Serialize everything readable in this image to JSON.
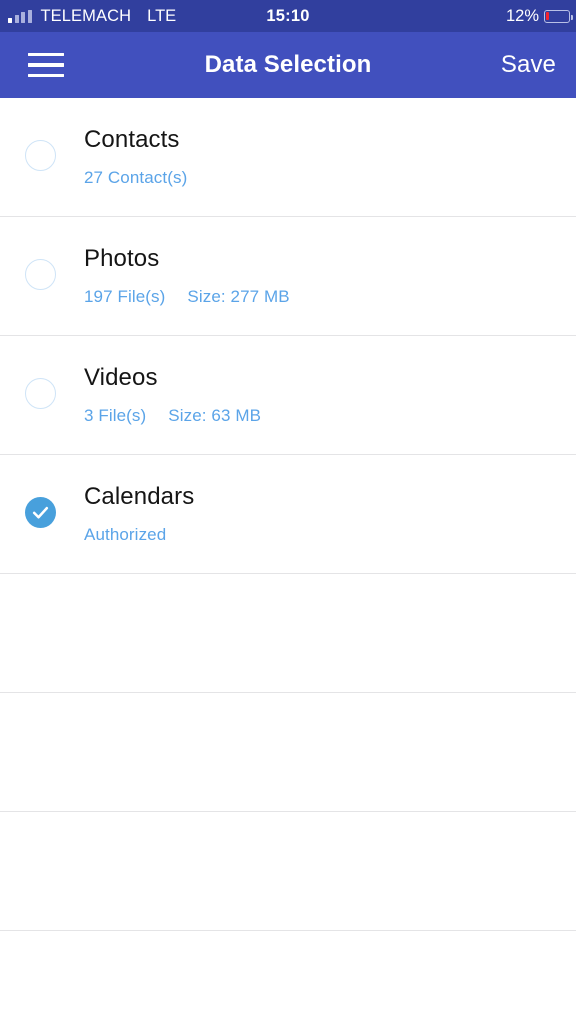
{
  "status_bar": {
    "carrier": "TELEMACH",
    "network": "LTE",
    "time": "15:10",
    "battery_percent_label": "12%",
    "battery_level": 12,
    "signal_bars": 4,
    "signal_icon": "signal-bars-icon",
    "battery_icon": "battery-icon",
    "battery_fill_color": "#f5222d"
  },
  "navbar": {
    "menu_icon": "hamburger-menu-icon",
    "title": "Data Selection",
    "save_label": "Save",
    "background_color": "#4150be"
  },
  "theme": {
    "status_bar_color": "#313f9e",
    "nav_color": "#4150be",
    "subtitle_color": "#5ba4e8",
    "checked_color": "#48a0dc",
    "unchecked_border_color": "#cfe4f7",
    "separator_color": "#e4e4e6"
  },
  "list": {
    "items": [
      {
        "title": "Contacts",
        "sub1": "27 Contact(s)",
        "sub2": "",
        "checked": false,
        "checkbox_name": "checkbox-contacts"
      },
      {
        "title": "Photos",
        "sub1": "197 File(s)",
        "sub2": "Size: 277 MB",
        "checked": false,
        "checkbox_name": "checkbox-photos"
      },
      {
        "title": "Videos",
        "sub1": "3 File(s)",
        "sub2": "Size: 63 MB",
        "checked": false,
        "checkbox_name": "checkbox-videos"
      },
      {
        "title": "Calendars",
        "sub1": "Authorized",
        "sub2": "",
        "checked": true,
        "checkbox_name": "checkbox-calendars"
      }
    ],
    "empty_row_count": 3
  }
}
